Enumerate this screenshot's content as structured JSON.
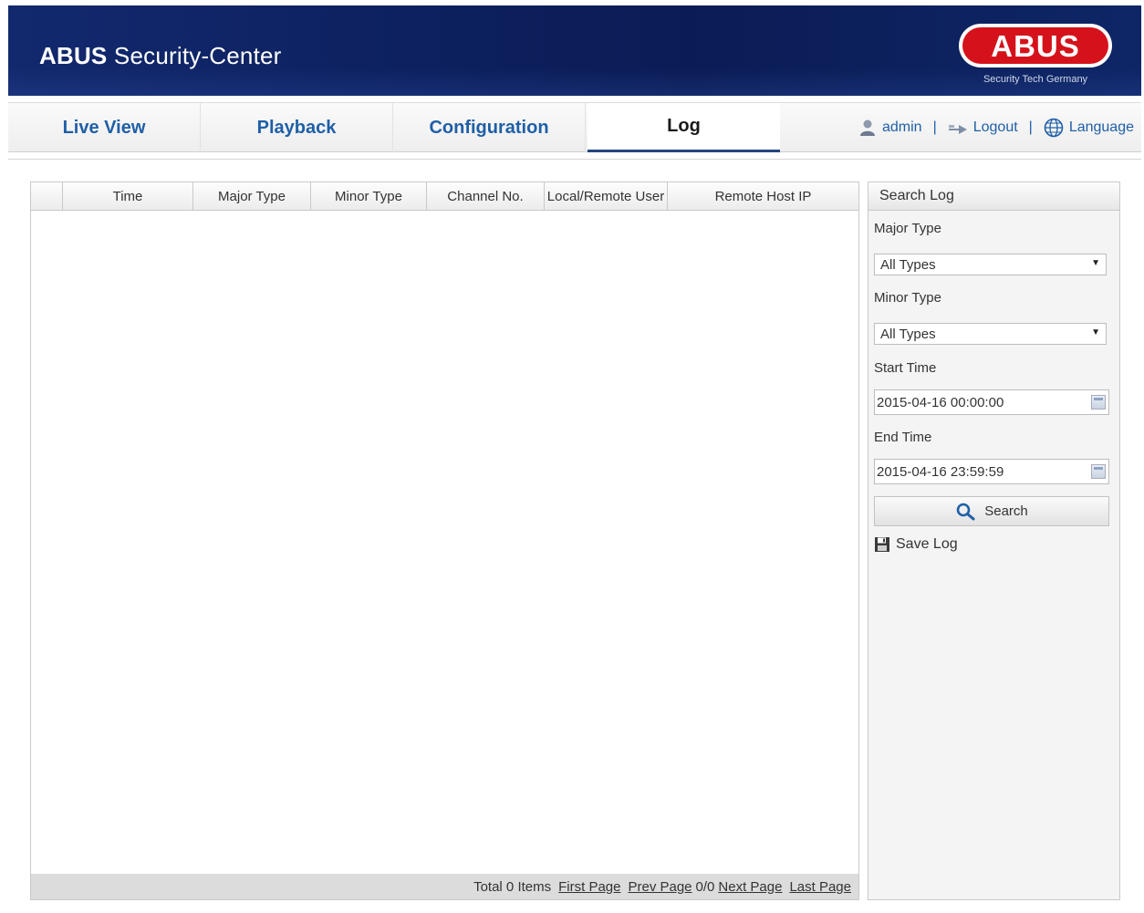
{
  "header": {
    "brand_bold": "ABUS",
    "brand_rest": "Security-Center",
    "logo_word": "ABUS",
    "logo_tagline": "Security Tech Germany"
  },
  "nav": {
    "tabs": [
      {
        "label": "Live View",
        "active": false
      },
      {
        "label": "Playback",
        "active": false
      },
      {
        "label": "Configuration",
        "active": false
      },
      {
        "label": "Log",
        "active": true
      }
    ],
    "user": "admin",
    "logout": "Logout",
    "language": "Language",
    "separator": "|"
  },
  "log_table": {
    "columns": [
      "",
      "Time",
      "Major Type",
      "Minor Type",
      "Channel No.",
      "Local/Remote User",
      "Remote Host IP"
    ],
    "rows": [],
    "footer": {
      "total": "Total 0 Items",
      "first": "First Page",
      "prev": "Prev Page",
      "page_info": "0/0",
      "next": "Next Page",
      "last": "Last Page"
    }
  },
  "search_panel": {
    "title": "Search Log",
    "major_type_label": "Major Type",
    "major_type_value": "All Types",
    "minor_type_label": "Minor Type",
    "minor_type_value": "All Types",
    "start_time_label": "Start Time",
    "start_time_value": "2015-04-16 00:00:00",
    "end_time_label": "End Time",
    "end_time_value": "2015-04-16 23:59:59",
    "search_label": "Search",
    "save_label": "Save Log"
  },
  "colors": {
    "header_bg": "#0d2160",
    "tab_text": "#1f5fa6",
    "logo_red": "#d5121b",
    "active_underline": "#23467f"
  },
  "icons": {
    "user": "user-icon",
    "logout": "logout-icon",
    "language": "globe-icon",
    "search": "magnifier-icon",
    "save": "floppy-disk-icon",
    "calendar": "calendar-icon",
    "dropdown": "chevron-down-icon"
  }
}
